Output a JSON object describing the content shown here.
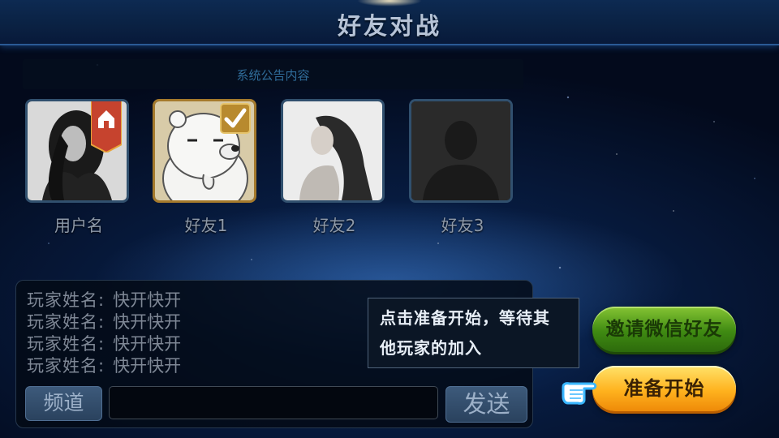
{
  "header": {
    "title": "好友对战"
  },
  "notice": {
    "text": "系统公告内容"
  },
  "players": [
    {
      "name": "用户名",
      "badge": "home-icon",
      "selected": false
    },
    {
      "name": "好友1",
      "badge": "check-icon",
      "selected": true
    },
    {
      "name": "好友2",
      "badge": null,
      "selected": false
    },
    {
      "name": "好友3",
      "badge": null,
      "selected": false
    }
  ],
  "chat": {
    "lines": [
      {
        "name": "玩家姓名:",
        "message": "快开快开"
      },
      {
        "name": "玩家姓名:",
        "message": "快开快开"
      },
      {
        "name": "玩家姓名:",
        "message": "快开快开"
      },
      {
        "name": "玩家姓名:",
        "message": "快开快开"
      }
    ],
    "channel_label": "频道",
    "input_value": "",
    "send_label": "发送"
  },
  "tooltip": {
    "line1": "点击准备开始，等待其",
    "line2": "他玩家的加入"
  },
  "buttons": {
    "invite_label": "邀请微信好友",
    "ready_label": "准备开始"
  },
  "colors": {
    "invite_green": "#3f8a12",
    "ready_orange": "#ffb21e",
    "selected_border": "#a57a2c",
    "badge_red": "#c6432e"
  }
}
